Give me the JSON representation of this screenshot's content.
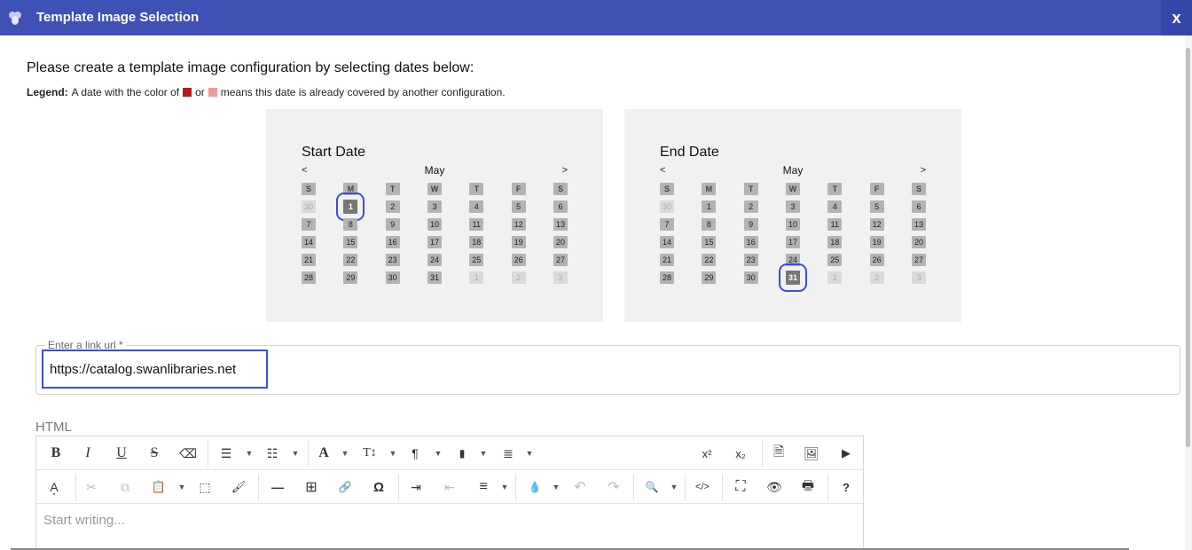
{
  "titlebar": {
    "title": "Template Image Selection",
    "close_label": "x",
    "app_icon": "bee-icon"
  },
  "instruction": "Please create a template image configuration by selecting dates below:",
  "legend": {
    "label": "Legend:",
    "text1": "A date with the color of",
    "or": "or",
    "text2": "means this date is already covered by another configuration.",
    "color_dark": "#b71c1c",
    "color_light": "#ef9a9a"
  },
  "start_calendar": {
    "title": "Start Date",
    "prev": "<",
    "next": ">",
    "month": "May",
    "weekdays": [
      "S",
      "M",
      "T",
      "W",
      "T",
      "F",
      "S"
    ],
    "weeks": [
      [
        "30",
        "1",
        "2",
        "3",
        "4",
        "5",
        "6"
      ],
      [
        "7",
        "8",
        "9",
        "10",
        "11",
        "12",
        "13"
      ],
      [
        "14",
        "15",
        "16",
        "17",
        "18",
        "19",
        "20"
      ],
      [
        "21",
        "22",
        "23",
        "24",
        "25",
        "26",
        "27"
      ],
      [
        "28",
        "29",
        "30",
        "31",
        "1",
        "2",
        "3"
      ]
    ],
    "selected": "1"
  },
  "end_calendar": {
    "title": "End Date",
    "prev": "<",
    "next": ">",
    "month": "May",
    "weekdays": [
      "S",
      "M",
      "T",
      "W",
      "T",
      "F",
      "S"
    ],
    "weeks": [
      [
        "30",
        "1",
        "2",
        "3",
        "4",
        "5",
        "6"
      ],
      [
        "7",
        "8",
        "9",
        "10",
        "11",
        "12",
        "13"
      ],
      [
        "14",
        "15",
        "16",
        "17",
        "18",
        "19",
        "20"
      ],
      [
        "21",
        "22",
        "23",
        "24",
        "25",
        "26",
        "27"
      ],
      [
        "28",
        "29",
        "30",
        "31",
        "1",
        "2",
        "3"
      ]
    ],
    "selected": "31"
  },
  "link_field": {
    "label": "Enter a link url *",
    "value": "https://catalog.swanlibraries.net"
  },
  "html_label": "HTML",
  "editor": {
    "placeholder": "Start writing...",
    "toolbar1": {
      "bold": "B",
      "italic": "I",
      "underline": "U",
      "strike": "S",
      "eraser": "⌫",
      "ul": "☰",
      "ol": "☷",
      "font": "A",
      "size": "T↕",
      "paragraph": "¶",
      "clip": "▮",
      "lineheight": "≣",
      "sup": "x²",
      "sub": "x₂",
      "file": "🗎",
      "image": "🖼",
      "video": "▶"
    },
    "toolbar2": {
      "spell": "A͙",
      "cut": "✂",
      "copy": "⧉",
      "paste": "📋",
      "select": "⬚",
      "paint": "🖌",
      "hr": "—",
      "table": "⊞",
      "link": "🔗",
      "omega": "Ω",
      "indent": "⇥",
      "outdent": "⇤",
      "align": "≡",
      "color": "💧",
      "undo": "↶",
      "redo": "↷",
      "find": "🔍",
      "source": "</>",
      "fullscreen": "⛶",
      "preview": "👁",
      "print": "🖶",
      "help": "?"
    }
  }
}
